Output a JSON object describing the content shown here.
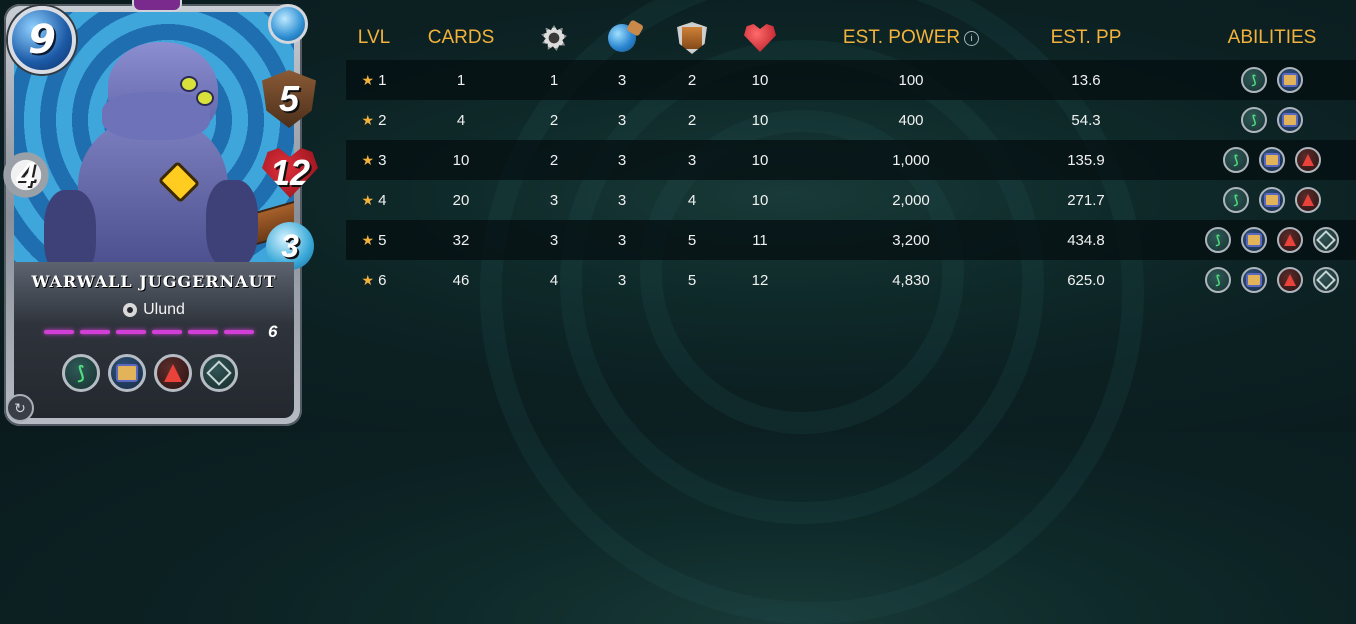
{
  "card": {
    "name": "WARWALL JUGGERNAUT",
    "faction": "Ulund",
    "mana": "9",
    "armor": "5",
    "health": "12",
    "melee": "4",
    "speed": "3",
    "level": "6",
    "level_bars": 6,
    "element_color": "#2e8fd3",
    "abilities": [
      "claw-icon",
      "fist-icon",
      "fire-icon",
      "diamond-icon"
    ]
  },
  "table": {
    "headers": {
      "lvl": "LVL",
      "cards": "CARDS",
      "attack_icon": "melee-attack-icon",
      "magic_icon": "speed-icon",
      "armor_icon": "armor-icon",
      "health_icon": "health-icon",
      "est_power": "EST. POWER",
      "est_pp": "EST. PP",
      "abilities": "ABILITIES"
    },
    "header_color": "#f2b23b",
    "rows": [
      {
        "lvl": "1",
        "cards": "1",
        "atk": "1",
        "mag": "3",
        "arm": "2",
        "hp": "10",
        "power": "100",
        "pp": "13.6",
        "abilities": [
          "claw-icon",
          "fist-icon"
        ]
      },
      {
        "lvl": "2",
        "cards": "4",
        "atk": "2",
        "mag": "3",
        "arm": "2",
        "hp": "10",
        "power": "400",
        "pp": "54.3",
        "abilities": [
          "claw-icon",
          "fist-icon"
        ]
      },
      {
        "lvl": "3",
        "cards": "10",
        "atk": "2",
        "mag": "3",
        "arm": "3",
        "hp": "10",
        "power": "1,000",
        "pp": "135.9",
        "abilities": [
          "claw-icon",
          "fist-icon",
          "fire-icon"
        ]
      },
      {
        "lvl": "4",
        "cards": "20",
        "atk": "3",
        "mag": "3",
        "arm": "4",
        "hp": "10",
        "power": "2,000",
        "pp": "271.7",
        "abilities": [
          "claw-icon",
          "fist-icon",
          "fire-icon"
        ]
      },
      {
        "lvl": "5",
        "cards": "32",
        "atk": "3",
        "mag": "3",
        "arm": "5",
        "hp": "11",
        "power": "3,200",
        "pp": "434.8",
        "abilities": [
          "claw-icon",
          "fist-icon",
          "fire-icon",
          "diamond-icon"
        ]
      },
      {
        "lvl": "6",
        "cards": "46",
        "atk": "4",
        "mag": "3",
        "arm": "5",
        "hp": "12",
        "power": "4,830",
        "pp": "625.0",
        "abilities": [
          "claw-icon",
          "fist-icon",
          "fire-icon",
          "diamond-icon"
        ]
      }
    ]
  }
}
